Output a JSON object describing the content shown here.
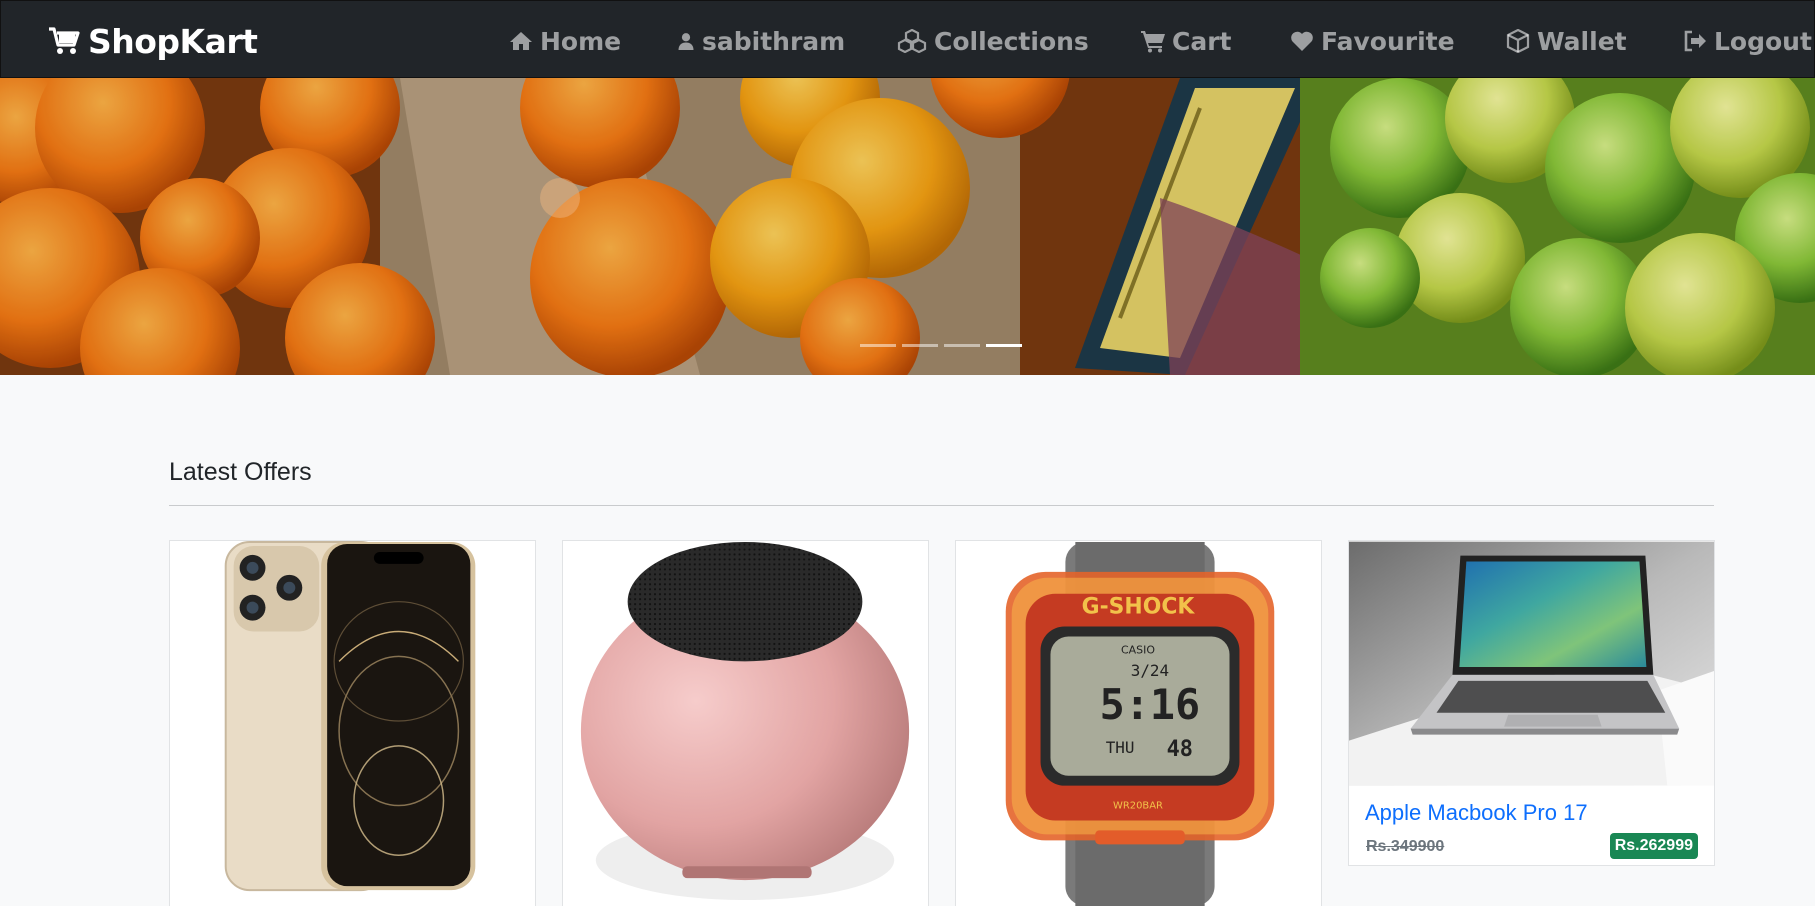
{
  "brand": {
    "name": "ShopKart",
    "icon": "shopping-cart-icon"
  },
  "nav": {
    "home": {
      "label": "Home",
      "icon": "home-icon"
    },
    "user": {
      "label": "sabithram",
      "icon": "user-icon"
    },
    "collections": {
      "label": "Collections",
      "icon": "cubes-icon"
    },
    "cart": {
      "label": "Cart",
      "icon": "cart-icon"
    },
    "favourite": {
      "label": "Favourite",
      "icon": "heart-icon"
    },
    "wallet": {
      "label": "Wallet",
      "icon": "box-icon"
    },
    "logout": {
      "label": "Logout",
      "icon": "sign-out-icon"
    }
  },
  "carousel": {
    "slide_count": 4,
    "active_index": 3
  },
  "offers": {
    "title": "Latest Offers",
    "products": [
      {
        "name": "",
        "old_price": "",
        "new_price": "",
        "image": "iphone-12-pro-gold"
      },
      {
        "name": "",
        "old_price": "",
        "new_price": "",
        "image": "mini-speaker-pink"
      },
      {
        "name": "",
        "old_price": "",
        "new_price": "",
        "image": "casio-gshock-watch"
      },
      {
        "name": "Apple Macbook Pro 17",
        "old_price": "Rs.349900",
        "new_price": "Rs.262999",
        "image": "macbook-pro"
      }
    ]
  },
  "colors": {
    "navbar": "#212529",
    "link": "#0d6efd",
    "price_badge": "#198754",
    "background": "#f8f9fa"
  }
}
